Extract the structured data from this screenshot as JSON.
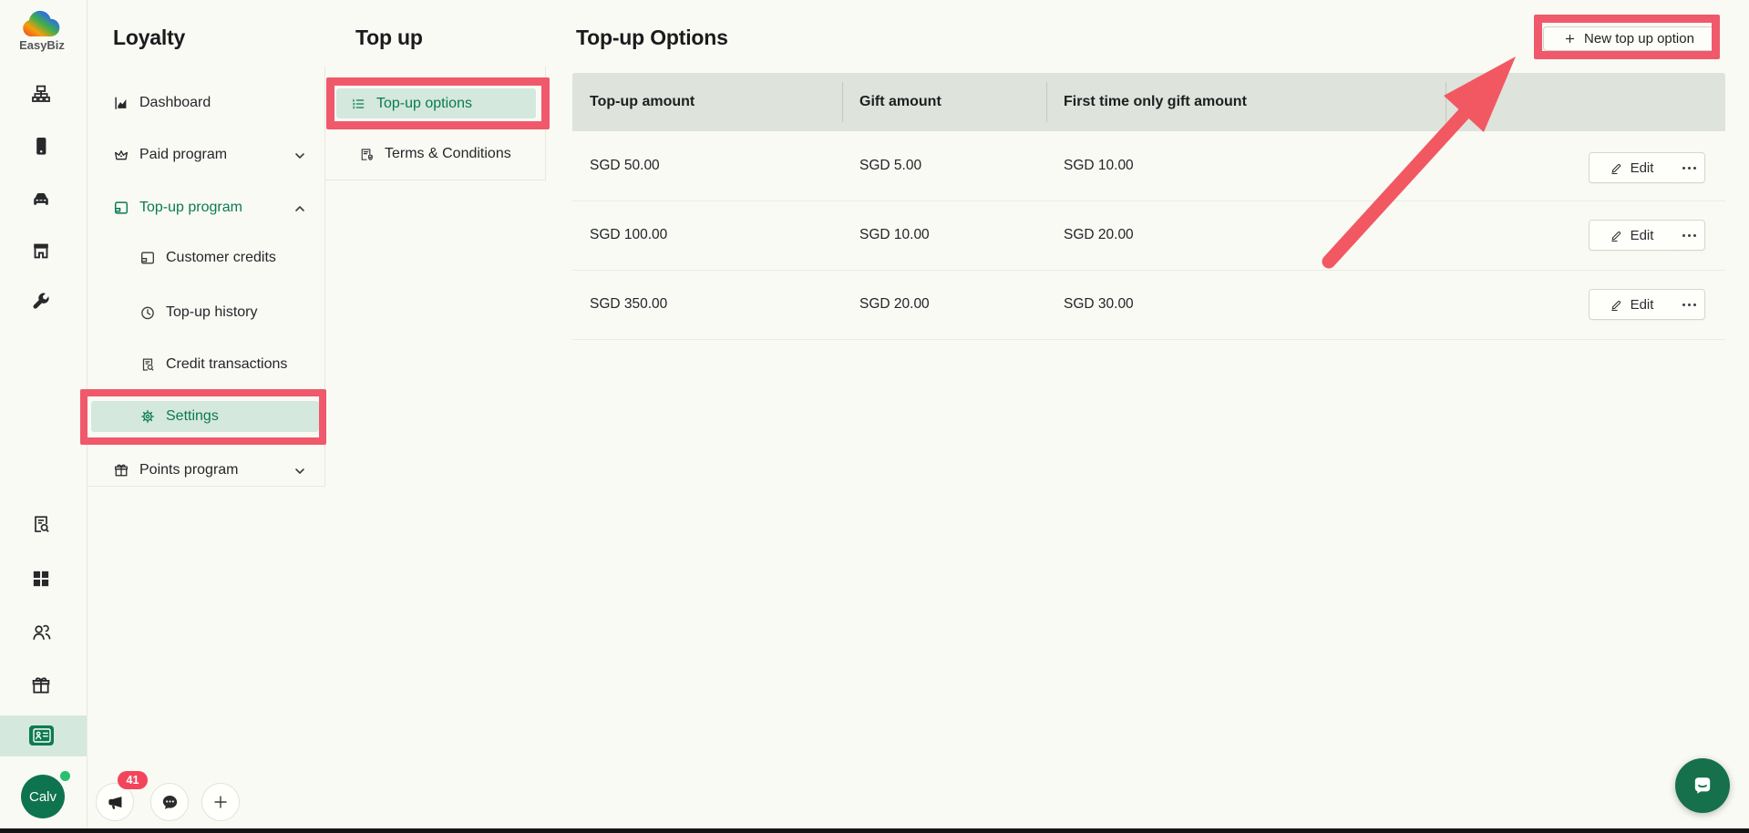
{
  "brand": {
    "name": "EasyBiz"
  },
  "rail": {
    "user": {
      "name": "Calv"
    },
    "notifications": {
      "count": "41"
    }
  },
  "loyalty_nav": {
    "title": "Loyalty",
    "items": [
      {
        "label": "Dashboard"
      },
      {
        "label": "Paid program"
      },
      {
        "label": "Top-up program"
      },
      {
        "label": "Customer credits"
      },
      {
        "label": "Top-up history"
      },
      {
        "label": "Credit transactions"
      },
      {
        "label": "Settings"
      },
      {
        "label": "Points program"
      }
    ]
  },
  "topup_nav": {
    "title": "Top up",
    "items": [
      {
        "label": "Top-up options"
      },
      {
        "label": "Terms & Conditions"
      }
    ]
  },
  "main": {
    "title": "Top-up Options",
    "new_button_label": "New top up option",
    "table": {
      "columns": [
        "Top-up amount",
        "Gift amount",
        "First time only gift amount"
      ],
      "rows": [
        {
          "topup": "SGD 50.00",
          "gift": "SGD 5.00",
          "first_time": "SGD 10.00"
        },
        {
          "topup": "SGD 100.00",
          "gift": "SGD 10.00",
          "first_time": "SGD 20.00"
        },
        {
          "topup": "SGD 350.00",
          "gift": "SGD 20.00",
          "first_time": "SGD 30.00"
        }
      ],
      "edit_label": "Edit"
    }
  },
  "colors": {
    "accent_green": "#0a7a55",
    "mint": "#d5e8dd",
    "annotation_red": "#f0596b",
    "header_band": "#dee3db",
    "avatar_green": "#0e744f",
    "badge_red": "#f2455c"
  }
}
